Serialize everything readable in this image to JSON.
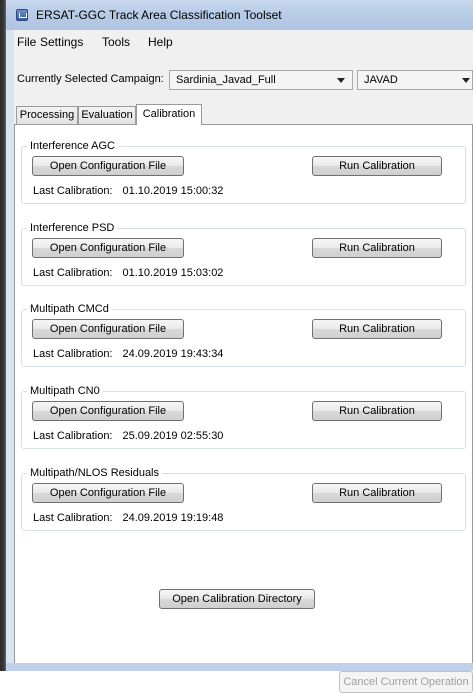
{
  "window": {
    "title": "ERSAT-GGC Track Area Classification Toolset"
  },
  "menu": {
    "items": [
      "File",
      "Settings",
      "Tools",
      "Help"
    ]
  },
  "campaign": {
    "label": "Currently Selected Campaign:",
    "selected": "Sardinia_Javad_Full",
    "receiver": "JAVAD"
  },
  "tabs": [
    {
      "label": "Processing",
      "active": false
    },
    {
      "label": "Evaluation",
      "active": false
    },
    {
      "label": "Calibration",
      "active": true
    }
  ],
  "calibration": {
    "open_label": "Open Configuration File",
    "run_label": "Run Calibration",
    "last_label": "Last Calibration:",
    "groups": [
      {
        "title": "Interference AGC",
        "last": "01.10.2019 15:00:32"
      },
      {
        "title": "Interference PSD",
        "last": "01.10.2019 15:03:02"
      },
      {
        "title": "Multipath CMCd",
        "last": "24.09.2019 19:43:34"
      },
      {
        "title": "Multipath CN0",
        "last": "25.09.2019 02:55:30"
      },
      {
        "title": "Multipath/NLOS Residuals",
        "last": "24.09.2019 19:19:48"
      }
    ],
    "open_dir_label": "Open Calibration Directory"
  },
  "footer": {
    "cancel_label": "Cancel Current Operation"
  },
  "icons": {
    "app": "app-window-icon",
    "dropdown": "chevron-down-icon"
  },
  "colors": {
    "titlebar": "#b7cbe6",
    "panel_bg": "#ffffff",
    "client_bg": "#f0f0f0"
  }
}
